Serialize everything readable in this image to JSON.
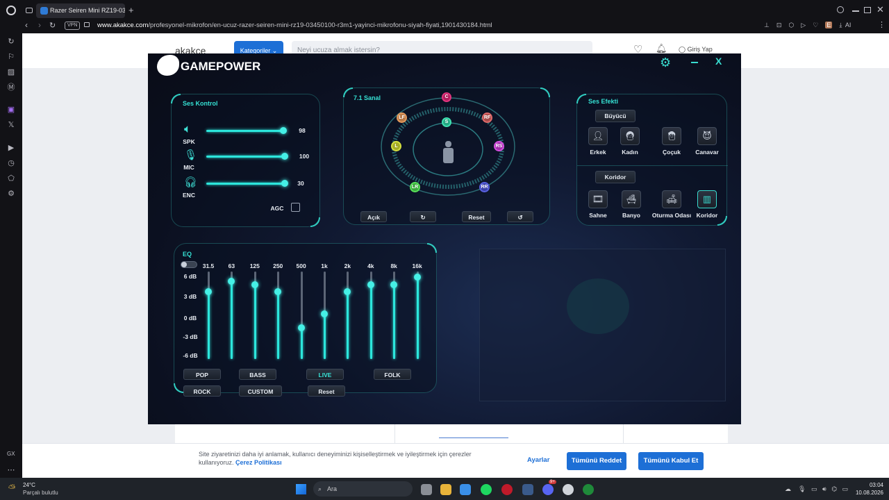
{
  "browser": {
    "tab_title": "Razer Seiren Mini RZ19-03",
    "url_host": "www.akakce.com",
    "url_path": "/profesyonel-mikrofon/en-ucuz-razer-seiren-mini-rz19-03450100-r3m1-yayinci-mikrofonu-siyah-fiyati,1901430184.html",
    "vpn_label": "VPN",
    "gx_label": "GX",
    "ai_label": "AI"
  },
  "site": {
    "logo": "akakce",
    "category_button": "Kategoriler",
    "search_placeholder": "Neyi ucuza almak istersin?",
    "login": "Giriş Yap"
  },
  "app": {
    "brand": "GAMEPOWER",
    "sound_control": {
      "title": "Ses Kontrol",
      "rows": [
        {
          "label": "SPK",
          "value": "98",
          "fraction": 0.98
        },
        {
          "label": "MIC",
          "value": "100",
          "fraction": 1.0
        },
        {
          "label": "ENC",
          "value": "30",
          "fraction": 1.0
        }
      ],
      "agc_label": "AGC"
    },
    "virtual": {
      "title": "7.1 Sanal",
      "speakers": [
        "C",
        "LF",
        "RF",
        "S",
        "L",
        "RS",
        "LR",
        "RR"
      ],
      "buttons": [
        "Açık",
        "Reset"
      ]
    },
    "effects": {
      "title": "Ses Efekti",
      "magic_tab": "Büyücü",
      "magic_items": [
        "Erkek",
        "Kadın",
        "Çoçuk",
        "Canavar"
      ],
      "corridor_tab": "Koridor",
      "corridor_items": [
        "Sahne",
        "Banyo",
        "Oturma Odası",
        "Koridor"
      ]
    },
    "eq": {
      "title": "EQ",
      "bands": [
        "31.5",
        "63",
        "125",
        "250",
        "500",
        "1k",
        "2k",
        "4k",
        "8k",
        "16k"
      ],
      "db_labels": [
        "6 dB",
        "3 dB",
        "0 dB",
        "-3 dB",
        "-6 dB"
      ],
      "band_db": [
        3,
        4.5,
        4,
        3,
        -2,
        0,
        3,
        4,
        4,
        5
      ],
      "presets_row1": [
        "POP",
        "BASS",
        "LIVE",
        "FOLK"
      ],
      "presets_row2": [
        "ROCK",
        "CUSTOM",
        "Reset"
      ],
      "active_preset": "LIVE"
    }
  },
  "cookie": {
    "text": "Site ziyaretinizi daha iyi anlamak, kullanıcı deneyiminizi kişiselleştirmek ve iyileştirmek için çerezler kullanıyoruz.",
    "policy_link": "Çerez Politikası",
    "settings": "Ayarlar",
    "reject_all": "Tümünü Reddet",
    "accept_all": "Tümünü Kabul Et"
  },
  "taskbar": {
    "temp": "24°C",
    "weather": "Parçalı bulutlu",
    "search": "Ara",
    "time": "03:04",
    "date": "10.08.2026",
    "badge": "9+"
  }
}
